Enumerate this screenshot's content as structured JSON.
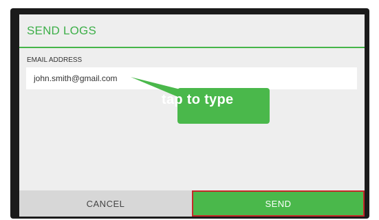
{
  "dialog": {
    "title": "SEND LOGS",
    "email_label": "EMAIL ADDRESS",
    "email_value": "john.smith@gmail.com",
    "cancel_label": "CANCEL",
    "send_label": "SEND"
  },
  "callout": {
    "text": "tap to type"
  },
  "colors": {
    "accent": "#45b549",
    "callout": "#4ab84b",
    "send_button": "#4ab84b",
    "send_outline": "#c62828",
    "dialog_bg": "#eeeeee"
  }
}
